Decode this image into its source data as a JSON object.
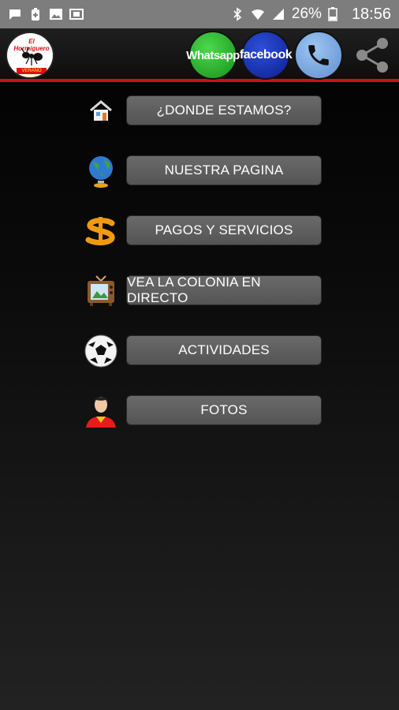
{
  "status_bar": {
    "battery": "26%",
    "time": "18:56",
    "left_icons": [
      "message-icon",
      "battery-saver-icon",
      "image-icon",
      "gallery-icon"
    ],
    "right_icons": [
      "bluetooth-icon",
      "wifi-icon",
      "signal-icon",
      "battery-icon"
    ]
  },
  "header": {
    "logo_top_text": "El Hormiguero",
    "logo_bottom_text": "VERANO 2016",
    "whatsapp_label": "Whatsapp",
    "facebook_label": "facebook",
    "phone_icon": "phone-icon",
    "share_icon": "share-icon"
  },
  "colors": {
    "accent_line": "#c8111b",
    "button_bg": "#5f5f5f",
    "whatsapp": "#1fa525",
    "facebook": "#1330b5",
    "phone": "#7aaae6"
  },
  "menu": {
    "items": [
      {
        "label": "¿DONDE ESTAMOS?",
        "icon": "house-icon"
      },
      {
        "label": "NUESTRA PAGINA",
        "icon": "globe-icon"
      },
      {
        "label": "PAGOS Y SERVICIOS",
        "icon": "dollar-icon"
      },
      {
        "label": "VEA LA COLONIA EN DIRECTO",
        "icon": "tv-icon"
      },
      {
        "label": "ACTIVIDADES",
        "icon": "soccer-ball-icon"
      },
      {
        "label": "FOTOS",
        "icon": "person-icon"
      }
    ]
  }
}
